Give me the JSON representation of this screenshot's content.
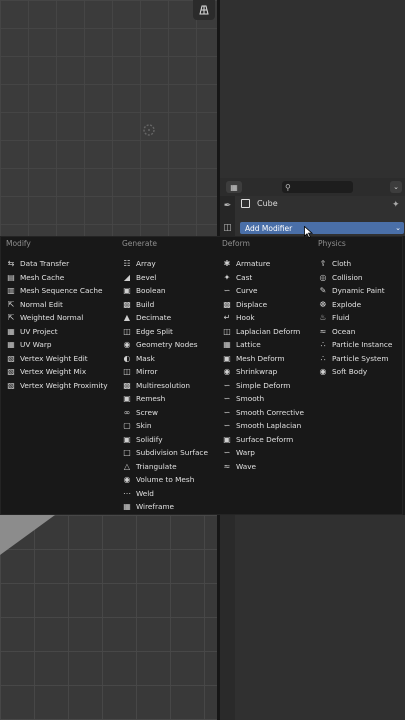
{
  "properties": {
    "object_name": "Cube",
    "add_modifier_label": "Add Modifier"
  },
  "menu": {
    "columns": [
      {
        "title": "Modify",
        "items": [
          {
            "label": "Data Transfer",
            "icon": "data-transfer-icon"
          },
          {
            "label": "Mesh Cache",
            "icon": "mesh-cache-icon"
          },
          {
            "label": "Mesh Sequence Cache",
            "icon": "mesh-sequence-cache-icon"
          },
          {
            "label": "Normal Edit",
            "icon": "normal-edit-icon"
          },
          {
            "label": "Weighted Normal",
            "icon": "weighted-normal-icon"
          },
          {
            "label": "UV Project",
            "icon": "uv-project-icon"
          },
          {
            "label": "UV Warp",
            "icon": "uv-warp-icon"
          },
          {
            "label": "Vertex Weight Edit",
            "icon": "vertex-weight-icon"
          },
          {
            "label": "Vertex Weight Mix",
            "icon": "vertex-weight-icon"
          },
          {
            "label": "Vertex Weight Proximity",
            "icon": "vertex-weight-icon"
          }
        ]
      },
      {
        "title": "Generate",
        "items": [
          {
            "label": "Array",
            "icon": "array-icon"
          },
          {
            "label": "Bevel",
            "icon": "bevel-icon"
          },
          {
            "label": "Boolean",
            "icon": "boolean-icon"
          },
          {
            "label": "Build",
            "icon": "build-icon"
          },
          {
            "label": "Decimate",
            "icon": "decimate-icon"
          },
          {
            "label": "Edge Split",
            "icon": "edge-split-icon"
          },
          {
            "label": "Geometry Nodes",
            "icon": "geometry-nodes-icon"
          },
          {
            "label": "Mask",
            "icon": "mask-icon"
          },
          {
            "label": "Mirror",
            "icon": "mirror-icon"
          },
          {
            "label": "Multiresolution",
            "icon": "multiresolution-icon"
          },
          {
            "label": "Remesh",
            "icon": "remesh-icon"
          },
          {
            "label": "Screw",
            "icon": "screw-icon"
          },
          {
            "label": "Skin",
            "icon": "skin-icon"
          },
          {
            "label": "Solidify",
            "icon": "solidify-icon"
          },
          {
            "label": "Subdivision Surface",
            "icon": "subdivision-icon"
          },
          {
            "label": "Triangulate",
            "icon": "triangulate-icon"
          },
          {
            "label": "Volume to Mesh",
            "icon": "volume-icon"
          },
          {
            "label": "Weld",
            "icon": "weld-icon"
          },
          {
            "label": "Wireframe",
            "icon": "wireframe-icon"
          }
        ]
      },
      {
        "title": "Deform",
        "items": [
          {
            "label": "Armature",
            "icon": "armature-icon"
          },
          {
            "label": "Cast",
            "icon": "cast-icon"
          },
          {
            "label": "Curve",
            "icon": "curve-icon"
          },
          {
            "label": "Displace",
            "icon": "displace-icon"
          },
          {
            "label": "Hook",
            "icon": "hook-icon"
          },
          {
            "label": "Laplacian Deform",
            "icon": "laplacian-icon"
          },
          {
            "label": "Lattice",
            "icon": "lattice-icon"
          },
          {
            "label": "Mesh Deform",
            "icon": "mesh-deform-icon"
          },
          {
            "label": "Shrinkwrap",
            "icon": "shrinkwrap-icon"
          },
          {
            "label": "Simple Deform",
            "icon": "simple-deform-icon"
          },
          {
            "label": "Smooth",
            "icon": "smooth-icon"
          },
          {
            "label": "Smooth Corrective",
            "icon": "smooth-icon"
          },
          {
            "label": "Smooth Laplacian",
            "icon": "smooth-icon"
          },
          {
            "label": "Surface Deform",
            "icon": "surface-deform-icon"
          },
          {
            "label": "Warp",
            "icon": "warp-icon"
          },
          {
            "label": "Wave",
            "icon": "wave-icon"
          }
        ]
      },
      {
        "title": "Physics",
        "items": [
          {
            "label": "Cloth",
            "icon": "cloth-icon"
          },
          {
            "label": "Collision",
            "icon": "collision-icon"
          },
          {
            "label": "Dynamic Paint",
            "icon": "dynamic-paint-icon"
          },
          {
            "label": "Explode",
            "icon": "explode-icon"
          },
          {
            "label": "Fluid",
            "icon": "fluid-icon"
          },
          {
            "label": "Ocean",
            "icon": "ocean-icon"
          },
          {
            "label": "Particle Instance",
            "icon": "particle-icon"
          },
          {
            "label": "Particle System",
            "icon": "particle-icon"
          },
          {
            "label": "Soft Body",
            "icon": "soft-body-icon"
          }
        ]
      }
    ]
  }
}
